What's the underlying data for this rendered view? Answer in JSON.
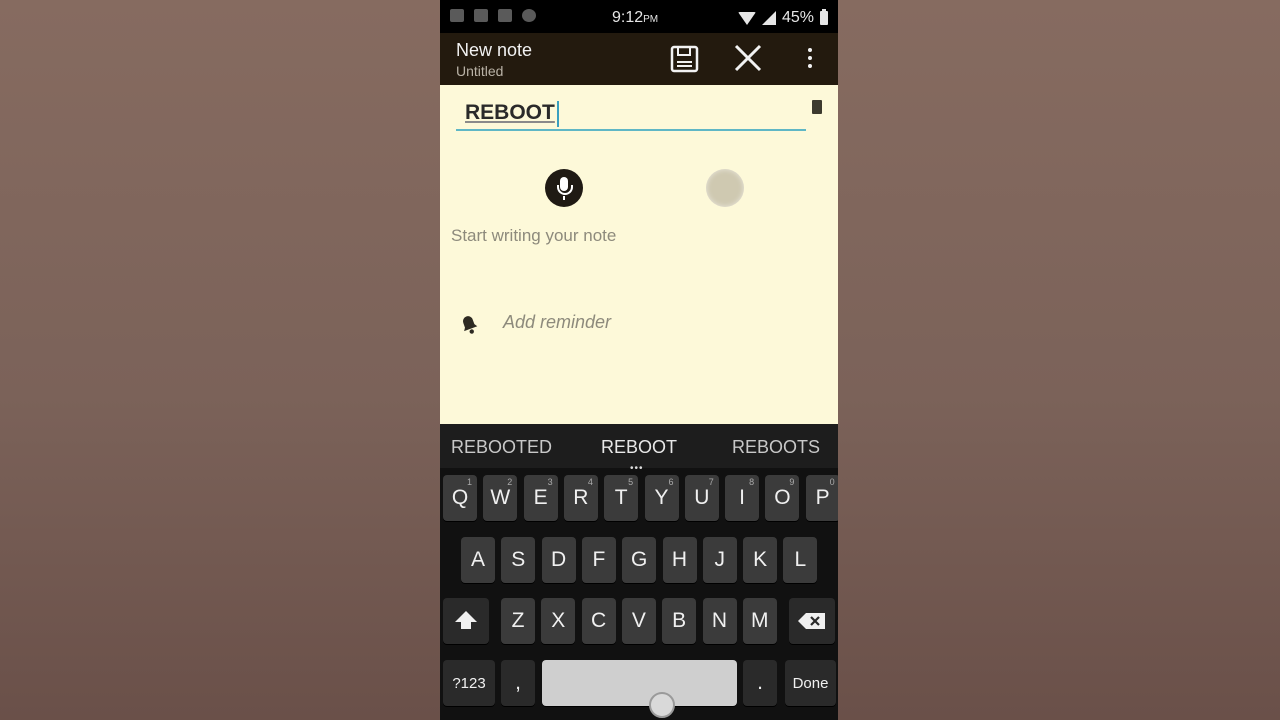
{
  "status_bar": {
    "time": "9:12",
    "time_suffix": "PM",
    "battery": "45%"
  },
  "app_bar": {
    "title": "New note",
    "subtitle": "Untitled"
  },
  "note": {
    "title_value": "REBOOT",
    "body_placeholder": "Start writing your note",
    "reminder_label": "Add reminder"
  },
  "keyboard": {
    "suggestions": [
      "REBOOTED",
      "REBOOT",
      "REBOOTS"
    ],
    "row1": [
      "Q",
      "W",
      "E",
      "R",
      "T",
      "Y",
      "U",
      "I",
      "O",
      "P"
    ],
    "row1_hints": [
      "1",
      "2",
      "3",
      "4",
      "5",
      "6",
      "7",
      "8",
      "9",
      "0"
    ],
    "row2": [
      "A",
      "S",
      "D",
      "F",
      "G",
      "H",
      "J",
      "K",
      "L"
    ],
    "row3": [
      "Z",
      "X",
      "C",
      "V",
      "B",
      "N",
      "M"
    ],
    "symbols_key": "?123",
    "comma_key": ",",
    "period_key": ".",
    "done_key": "Done"
  }
}
